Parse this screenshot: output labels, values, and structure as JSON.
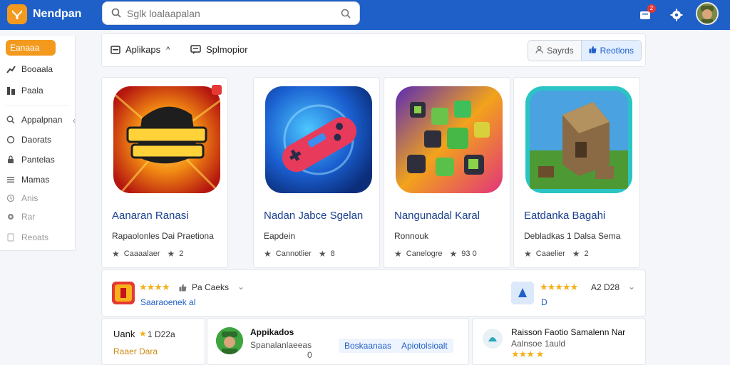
{
  "header": {
    "brand": "Nendpan",
    "search_placeholder": "Sglk loalaapalan",
    "notification_count": "2"
  },
  "sidebar": {
    "items": [
      {
        "label": "Eanaaa",
        "icon": "home-icon",
        "active": true
      },
      {
        "label": "Booaala",
        "icon": "trend-icon"
      },
      {
        "label": "Paala",
        "icon": "grid-icon"
      },
      {
        "label": "Appalpnan",
        "icon": "search-icon"
      },
      {
        "label": "Daorats",
        "icon": "tag-icon"
      },
      {
        "label": "Pantelas",
        "icon": "lock-icon"
      },
      {
        "label": "Mamas",
        "icon": "list-icon"
      },
      {
        "label": "Anis",
        "icon": "clock-icon"
      },
      {
        "label": "Rar",
        "icon": "gear-icon"
      },
      {
        "label": "Reoats",
        "icon": "doc-icon"
      }
    ]
  },
  "toolbar": {
    "apps_label": "Aplikaps",
    "split_label": "Splmopior",
    "seg_left": "Sayrds",
    "seg_right": "Reotlons"
  },
  "cards": [
    {
      "name": "Aanaran Ranasi",
      "developer": "Rapaolonles Dai Praetiona",
      "category": "Caaaalaer",
      "rating": "2",
      "icon": "game-banner-icon"
    },
    {
      "name": "Nadan Jabce Sgelan",
      "developer": "Eapdein",
      "category": "Cannotlier",
      "rating": "8",
      "icon": "gamepad-icon"
    },
    {
      "name": "Nangunadal Karal",
      "developer": "Ronnouk",
      "category": "Canelogre",
      "rating": "93 0",
      "icon": "block-puzzle-icon"
    },
    {
      "name": "Eatdanka Bagahi",
      "developer": "Debladkas 1 Dalsa Sema",
      "category": "Caaelier",
      "rating": "2",
      "icon": "castle-builder-icon"
    }
  ],
  "rating_row": {
    "left_text": "Pa Caeks",
    "left_sub": "Saaraoenek al",
    "right_text": "A2 D28",
    "right_sub": "D"
  },
  "bottom": {
    "left_title": "Uank",
    "left_rating": "1 D22a",
    "left_sub": "Raaer Dara",
    "middle_title": "Appikados",
    "middle_sub": "Spanalanlaeeas",
    "middle_count": "0",
    "tag_one": "Boskaanaas",
    "tag_two": "Apiotolsioalt",
    "right_title": "Raisson Faotio Samalenn Nar",
    "right_sub": "Aalnsoe 1auld"
  },
  "colors": {
    "header": "#1f5fc8",
    "accent": "#f39a1e",
    "link": "#1a3f8f",
    "star": "#f3b01b"
  }
}
